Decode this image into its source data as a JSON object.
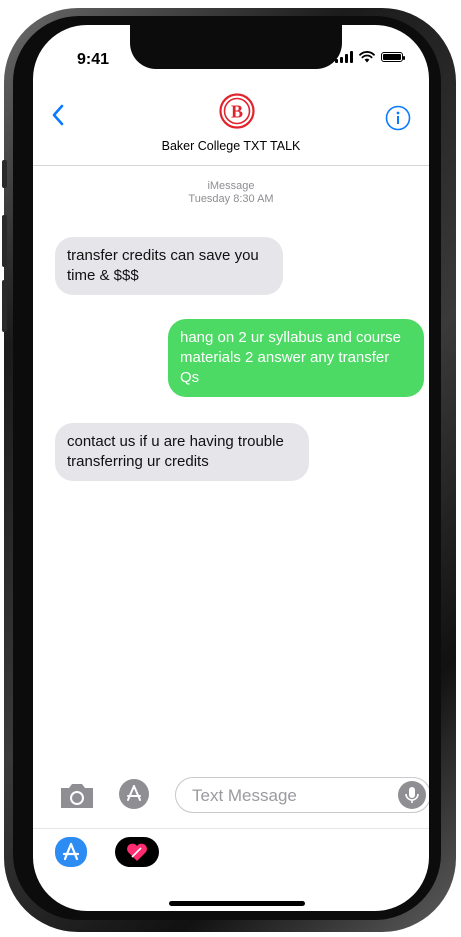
{
  "status_bar": {
    "time": "9:41"
  },
  "header": {
    "contact_name": "Baker College TXT TALK",
    "logo_letter": "B"
  },
  "conversation": {
    "service": "iMessage",
    "timestamp": "Tuesday  8:30 AM",
    "messages": [
      {
        "direction": "incoming",
        "text": "transfer credits can save you time & $$$"
      },
      {
        "direction": "outgoing",
        "text": "hang on 2 ur syllabus and course materials 2 answer any transfer Qs"
      },
      {
        "direction": "incoming",
        "text": "contact us if u are having trouble transferring ur credits"
      }
    ]
  },
  "compose": {
    "placeholder": "Text Message"
  },
  "colors": {
    "incoming_bubble": "#e5e5ea",
    "outgoing_bubble": "#4cd964",
    "accent": "#0a7aff",
    "logo": "#e0242d"
  }
}
